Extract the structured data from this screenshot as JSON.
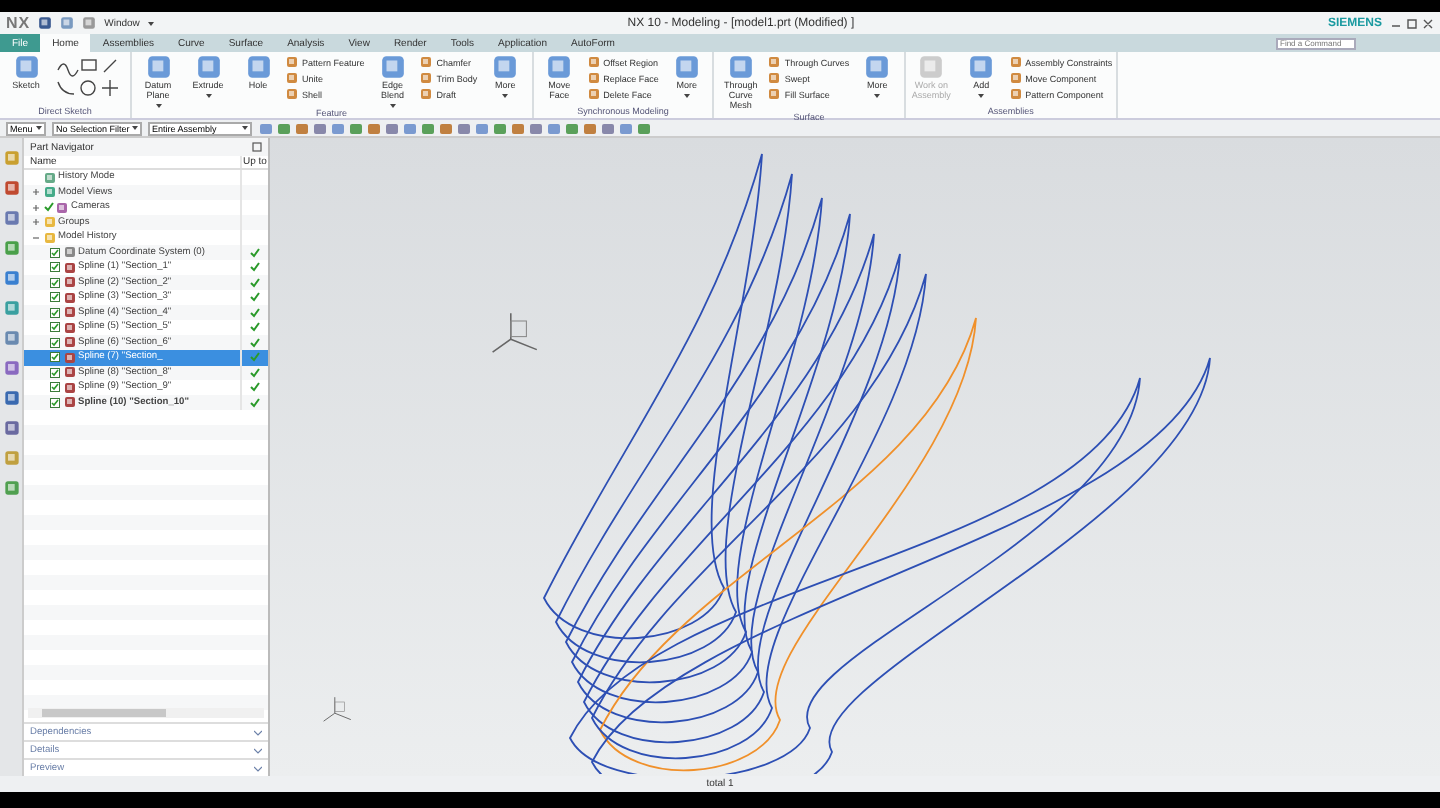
{
  "window": {
    "logo": "NX",
    "menu": "Window",
    "title": "NX 10 - Modeling - [model1.prt (Modified) ]",
    "brand": "SIEMENS"
  },
  "tabs": [
    {
      "label": "File",
      "kind": "file",
      "selected": false
    },
    {
      "label": "Home",
      "kind": "tab",
      "selected": true
    },
    {
      "label": "Assemblies",
      "kind": "tab",
      "selected": false
    },
    {
      "label": "Curve",
      "kind": "tab",
      "selected": false
    },
    {
      "label": "Surface",
      "kind": "tab",
      "selected": false
    },
    {
      "label": "Analysis",
      "kind": "tab",
      "selected": false
    },
    {
      "label": "View",
      "kind": "tab",
      "selected": false
    },
    {
      "label": "Render",
      "kind": "tab",
      "selected": false
    },
    {
      "label": "Tools",
      "kind": "tab",
      "selected": false
    },
    {
      "label": "Application",
      "kind": "tab",
      "selected": false
    },
    {
      "label": "AutoForm",
      "kind": "tab",
      "selected": false
    }
  ],
  "command_search": {
    "placeholder": "Find a Command"
  },
  "ribbon_groups": [
    {
      "label": "Direct Sketch",
      "tools": [
        {
          "kind": "large",
          "label": "Sketch",
          "menu": false,
          "disabled": false
        },
        {
          "kind": "sketch_grid"
        }
      ]
    },
    {
      "label": "Feature",
      "tools": [
        {
          "kind": "large",
          "label": "Datum Plane",
          "menu": true,
          "disabled": false
        },
        {
          "kind": "large",
          "label": "Extrude",
          "menu": true,
          "disabled": false
        },
        {
          "kind": "large",
          "label": "Hole",
          "menu": false,
          "disabled": false
        },
        {
          "kind": "stack",
          "items": [
            "Pattern Feature",
            "Unite",
            "Shell"
          ]
        },
        {
          "kind": "large",
          "label": "Edge Blend",
          "menu": true,
          "disabled": false
        },
        {
          "kind": "stack",
          "items": [
            "Chamfer",
            "Trim Body",
            "Draft"
          ]
        },
        {
          "kind": "large",
          "label": "More",
          "menu": true,
          "disabled": false
        }
      ]
    },
    {
      "label": "Synchronous Modeling",
      "tools": [
        {
          "kind": "large",
          "label": "Move Face",
          "menu": false,
          "disabled": false
        },
        {
          "kind": "stack",
          "items": [
            "Offset Region",
            "Replace Face",
            "Delete Face"
          ]
        },
        {
          "kind": "large",
          "label": "More",
          "menu": true,
          "disabled": false
        }
      ]
    },
    {
      "label": "Surface",
      "tools": [
        {
          "kind": "large",
          "label": "Through Curve Mesh",
          "menu": false,
          "disabled": false
        },
        {
          "kind": "stack",
          "items": [
            "Through Curves",
            "Swept",
            "Fill Surface"
          ]
        },
        {
          "kind": "large",
          "label": "More",
          "menu": true,
          "disabled": false
        }
      ]
    },
    {
      "label": "Assemblies",
      "tools": [
        {
          "kind": "large",
          "label": "Work on Assembly",
          "menu": false,
          "disabled": true
        },
        {
          "kind": "large",
          "label": "Add",
          "menu": true,
          "disabled": false
        },
        {
          "kind": "stack",
          "items": [
            "Assembly Constraints",
            "Move Component",
            "Pattern Component"
          ]
        }
      ]
    }
  ],
  "selection_bar": {
    "menu": "Menu",
    "filter": "No Selection Filter",
    "scope": "Entire Assembly"
  },
  "navigator": {
    "title": "Part Navigator",
    "columns": [
      "Name",
      "Up to"
    ],
    "tree": [
      {
        "label": "History Mode",
        "kind": "mode"
      },
      {
        "label": "Model Views",
        "kind": "views",
        "expanded": false
      },
      {
        "label": "Cameras",
        "kind": "camera",
        "expanded": false,
        "checked": true
      },
      {
        "label": "Groups",
        "kind": "folder",
        "expanded": false
      },
      {
        "label": "Model History",
        "kind": "folder",
        "expanded": true,
        "children": [
          {
            "label": "Datum Coordinate System (0)",
            "kind": "datum",
            "checked": true,
            "up_to": true,
            "selected": false,
            "current": false
          },
          {
            "label": "Spline (1) \"Section_1\"",
            "kind": "spline",
            "checked": true,
            "up_to": true,
            "selected": false,
            "current": false
          },
          {
            "label": "Spline (2) \"Section_2\"",
            "kind": "spline",
            "checked": true,
            "up_to": true,
            "selected": false,
            "current": false
          },
          {
            "label": "Spline (3) \"Section_3\"",
            "kind": "spline",
            "checked": true,
            "up_to": true,
            "selected": false,
            "current": false
          },
          {
            "label": "Spline (4) \"Section_4\"",
            "kind": "spline",
            "checked": true,
            "up_to": true,
            "selected": false,
            "current": false
          },
          {
            "label": "Spline (5) \"Section_5\"",
            "kind": "spline",
            "checked": true,
            "up_to": true,
            "selected": false,
            "current": false
          },
          {
            "label": "Spline (6) \"Section_6\"",
            "kind": "spline",
            "checked": true,
            "up_to": true,
            "selected": false,
            "current": false
          },
          {
            "label": "Spline (7) \"Section_",
            "kind": "spline",
            "checked": true,
            "up_to": true,
            "selected": true,
            "current": false
          },
          {
            "label": "Spline (8) \"Section_8\"",
            "kind": "spline",
            "checked": true,
            "up_to": true,
            "selected": false,
            "current": false
          },
          {
            "label": "Spline (9) \"Section_9\"",
            "kind": "spline",
            "checked": true,
            "up_to": true,
            "selected": false,
            "current": false
          },
          {
            "label": "Spline (10) \"Section_10\"",
            "kind": "spline",
            "checked": true,
            "up_to": true,
            "selected": false,
            "current": true
          }
        ]
      }
    ],
    "sections": [
      {
        "label": "Dependencies",
        "expanded": false
      },
      {
        "label": "Details",
        "expanded": false
      },
      {
        "label": "Preview",
        "expanded": false
      }
    ]
  },
  "status_bar": {
    "text": "total 1"
  }
}
